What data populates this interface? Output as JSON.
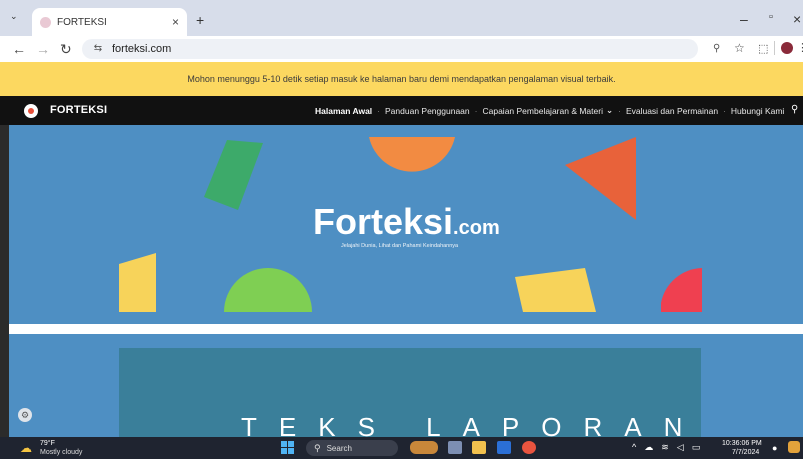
{
  "browser": {
    "tab_title": "FORTEKSI",
    "url": "forteksi.com",
    "new_tab_label": "+",
    "tab_close": "×",
    "window_controls": {
      "minimize": "–",
      "maximize": "▫",
      "close": "×"
    }
  },
  "notice": {
    "text": "Mohon menunggu 5-10 detik setiap masuk ke halaman baru demi mendapatkan pengalaman visual terbaik."
  },
  "site": {
    "brand": "FORTEKSI",
    "nav": [
      "Halaman Awal",
      "Panduan Penggunaan",
      "Capaian Pembelajaran & Materi",
      "Evaluasi dan Permainan",
      "Hubungi Kami"
    ],
    "dropdown_glyph": "⌄",
    "separator": "·",
    "search_icon": "search-icon"
  },
  "hero": {
    "title": "Forteksi",
    "title_suffix": ".com",
    "subtitle": "Jelajahi Dunia, Lihat dan Pahami Keindahannya",
    "colors": {
      "background": "#4e8fc3",
      "green": "#3daa6a",
      "orange": "#f28b42",
      "red_orange": "#e8623a",
      "yellow": "#f7d35a",
      "lime": "#7fcf53",
      "red": "#ef4050"
    }
  },
  "section2": {
    "heading": "TEKS LAPORAN"
  },
  "taskbar": {
    "weather_temp": "79°F",
    "weather_desc": "Mostly cloudy",
    "search_label": "Search",
    "time": "10:36:06 PM",
    "date": "7/7/2024"
  }
}
